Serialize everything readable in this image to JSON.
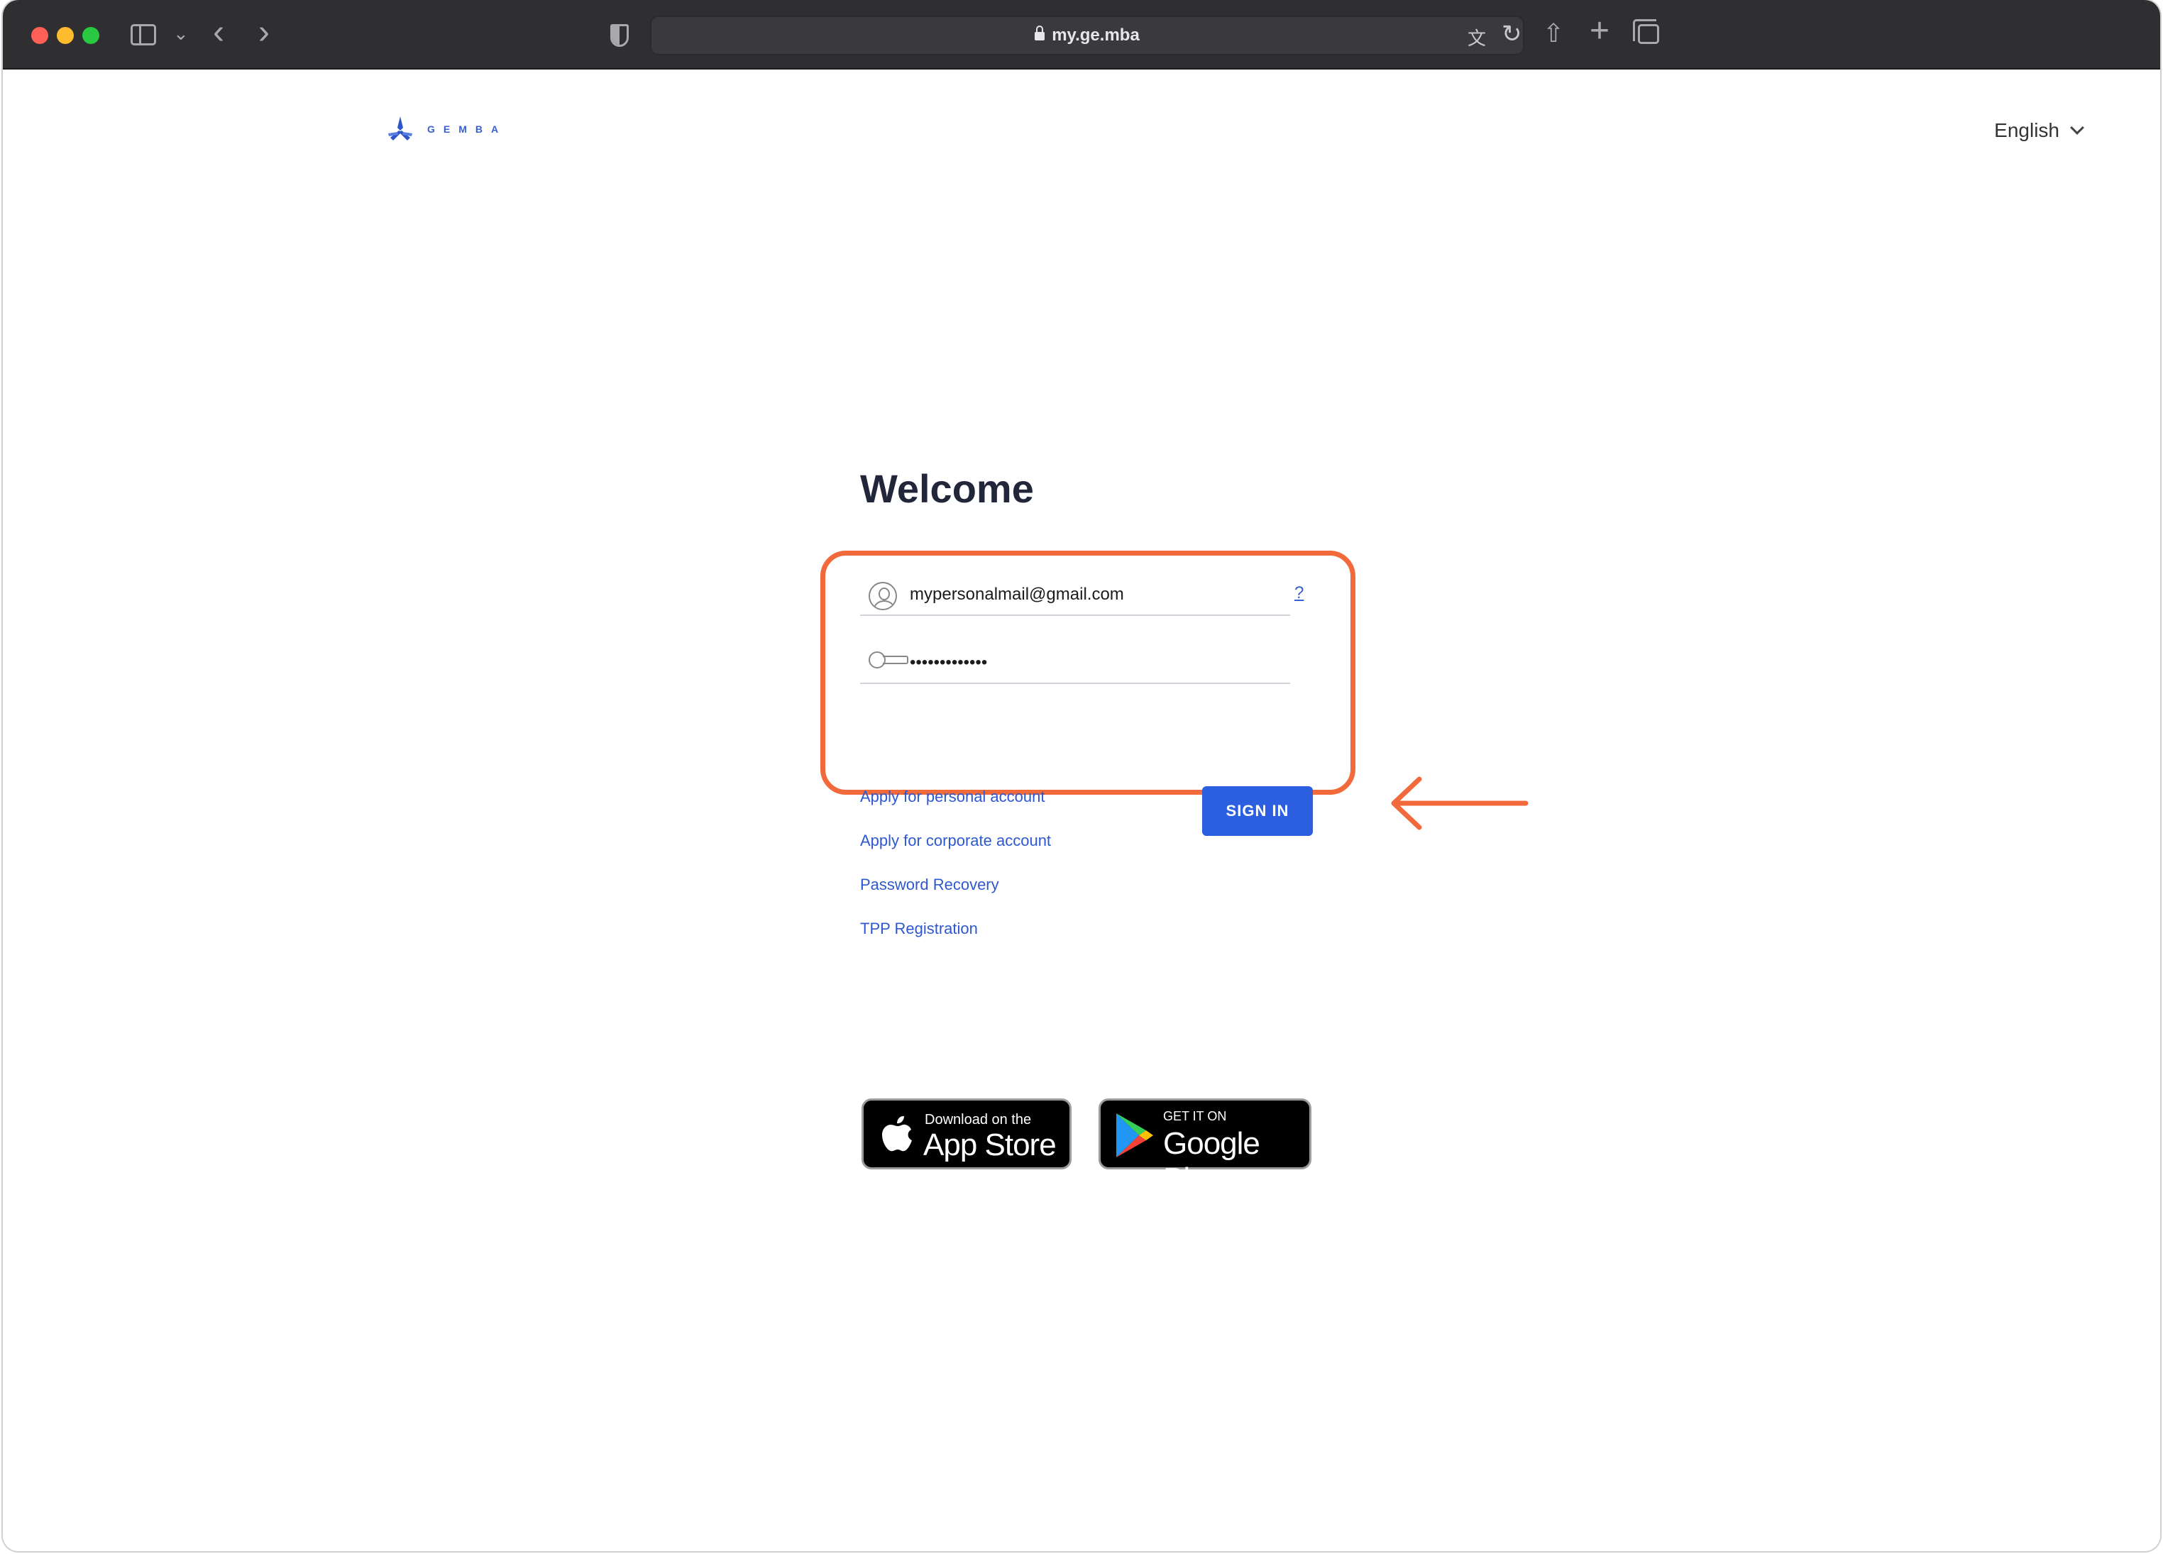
{
  "browser": {
    "url": "my.ge.mba"
  },
  "header": {
    "logo_text": "GEMBA",
    "language": "English"
  },
  "login": {
    "title": "Welcome",
    "email_value": "mypersonalmail@gmail.com",
    "password_value": "•••••••••••••",
    "help_label": "?",
    "sign_in_label": "SIGN IN",
    "links": {
      "personal": "Apply for personal account",
      "corporate": "Apply for corporate account",
      "recovery": "Password Recovery",
      "tpp": "TPP Registration"
    }
  },
  "stores": {
    "apple_small": "Download on the",
    "apple_big": "App Store",
    "google_small": "GET IT ON",
    "google_big": "Google Play"
  },
  "colors": {
    "accent": "#2b5fe0",
    "highlight": "#f26a3b",
    "link": "#2e58d0"
  }
}
